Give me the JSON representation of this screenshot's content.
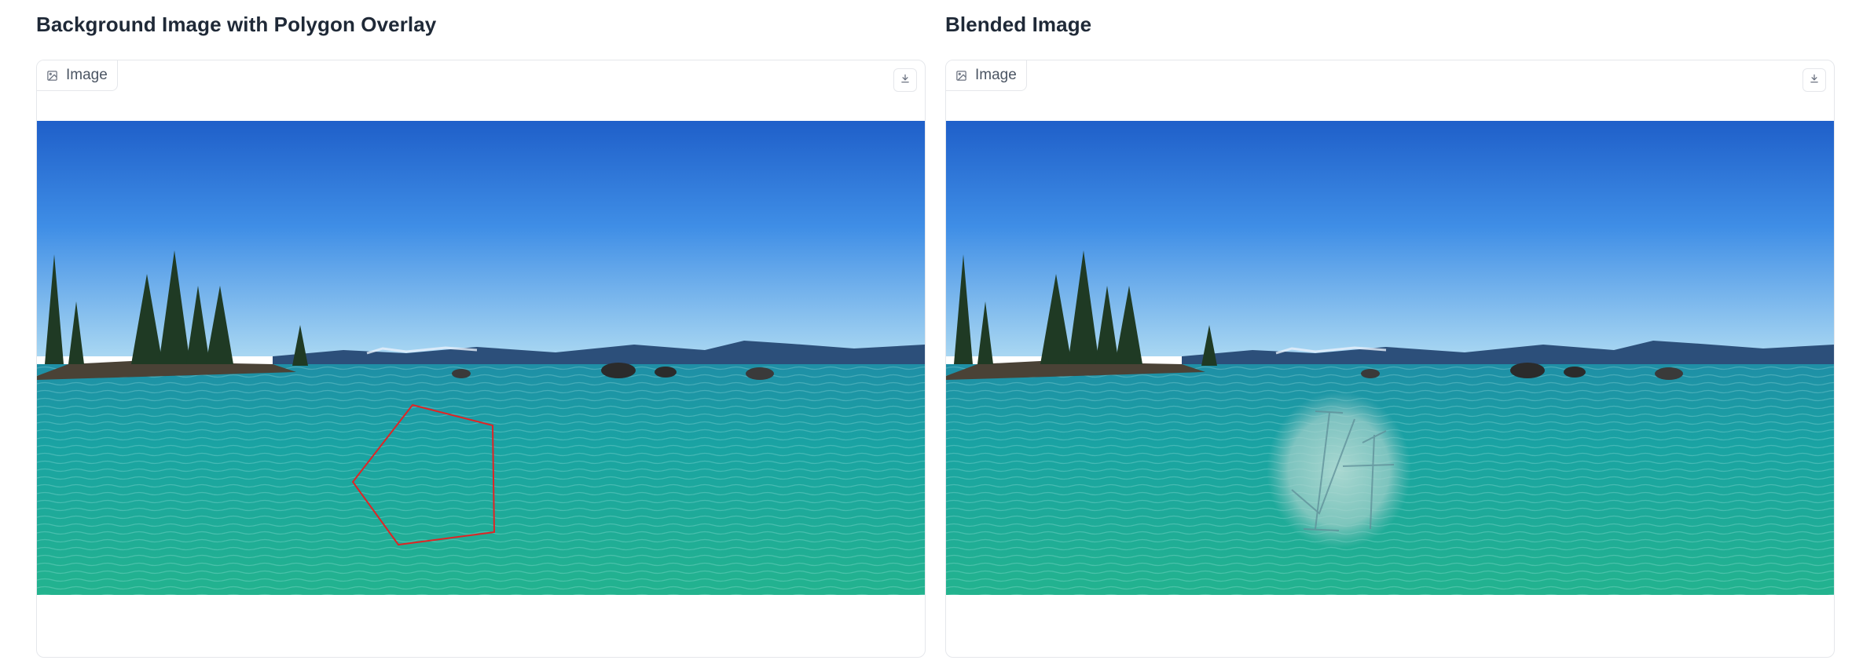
{
  "panels": [
    {
      "heading": "Background Image with Polygon Overlay",
      "tab_label": "Image",
      "tab_icon": "image-icon",
      "download_icon": "download-icon",
      "overlay": "polygon"
    },
    {
      "heading": "Blended Image",
      "tab_label": "Image",
      "tab_icon": "image-icon",
      "download_icon": "download-icon",
      "overlay": "blended-patch"
    }
  ],
  "colors": {
    "polygon_stroke": "#e02424",
    "panel_border": "#e5e7eb",
    "heading_text": "#1f2937"
  }
}
